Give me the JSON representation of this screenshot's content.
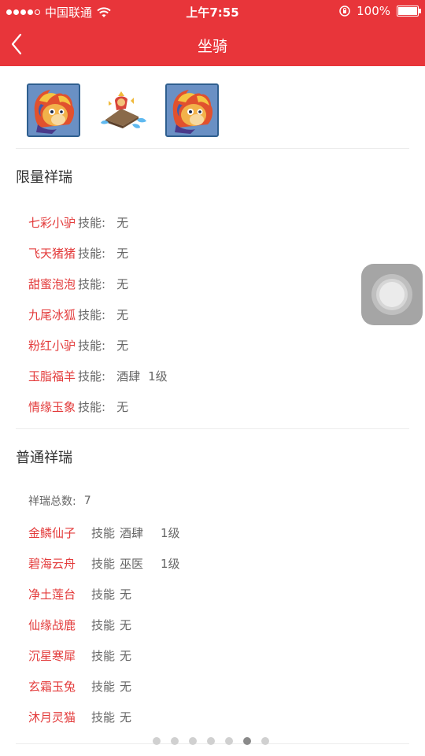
{
  "status_bar": {
    "carrier": "中国联通",
    "time": "上午7:55",
    "battery": "100%"
  },
  "nav": {
    "title": "坐骑"
  },
  "limited": {
    "title": "限量祥瑞",
    "skill_label": "技能:",
    "items": [
      {
        "name": "七彩小驴",
        "skill": "无"
      },
      {
        "name": "飞天猪猪",
        "skill": "无"
      },
      {
        "name": "甜蜜泡泡",
        "skill": "无"
      },
      {
        "name": "九尾冰狐",
        "skill": "无"
      },
      {
        "name": "粉红小驴",
        "skill": "无"
      },
      {
        "name": "玉脂福羊",
        "skill": "酒肆",
        "level": "1级"
      },
      {
        "name": "情缘玉象",
        "skill": "无"
      }
    ]
  },
  "normal": {
    "title": "普通祥瑞",
    "total_label": "祥瑞总数:",
    "total": "7",
    "skill_label": "技能",
    "items": [
      {
        "name": "金鳞仙子",
        "skill": "酒肆",
        "level": "1级"
      },
      {
        "name": "碧海云舟",
        "skill": "巫医",
        "level": "1级"
      },
      {
        "name": "净土莲台",
        "skill": "无"
      },
      {
        "name": "仙缘战鹿",
        "skill": "无"
      },
      {
        "name": "沉星寒犀",
        "skill": "无"
      },
      {
        "name": "玄霜玉兔",
        "skill": "无"
      },
      {
        "name": "沐月灵猫",
        "skill": "无"
      }
    ]
  },
  "pager": {
    "count": 7,
    "active_index": 5
  },
  "colors": {
    "brand": "#e8353a",
    "name": "#e33b3b"
  }
}
